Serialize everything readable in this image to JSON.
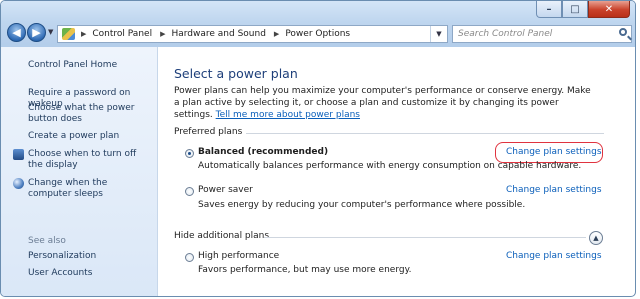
{
  "window": {
    "caption_buttons": {
      "minimize": "–",
      "maximize": "□",
      "close": "✕"
    }
  },
  "nav": {
    "back_icon": "◀",
    "forward_icon": "▶",
    "breadcrumbs": [
      "Control Panel",
      "Hardware and Sound",
      "Power Options"
    ],
    "refresh_icon": "↻",
    "search_placeholder": "Search Control Panel"
  },
  "sidebar": {
    "home": "Control Panel Home",
    "items": [
      "Require a password on wakeup",
      "Choose what the power button does",
      "Create a power plan",
      "Choose when to turn off the display",
      "Change when the computer sleeps"
    ],
    "see_also_header": "See also",
    "see_also": [
      "Personalization",
      "User Accounts"
    ]
  },
  "main": {
    "title": "Select a power plan",
    "intro_text": "Power plans can help you maximize your computer's performance or conserve energy. Make a plan active by selecting it, or choose a plan and customize it by changing its power settings.",
    "intro_link": "Tell me more about power plans",
    "preferred_header": "Preferred plans",
    "hidden_header": "Hide additional plans",
    "change_label": "Change plan settings",
    "plans": [
      {
        "name": "Balanced (recommended)",
        "description": "Automatically balances performance with energy consumption on capable hardware.",
        "selected": true
      },
      {
        "name": "Power saver",
        "description": "Saves energy by reducing your computer's performance where possible.",
        "selected": false
      },
      {
        "name": "High performance",
        "description": "Favors performance, but may use more energy.",
        "selected": false
      }
    ]
  }
}
